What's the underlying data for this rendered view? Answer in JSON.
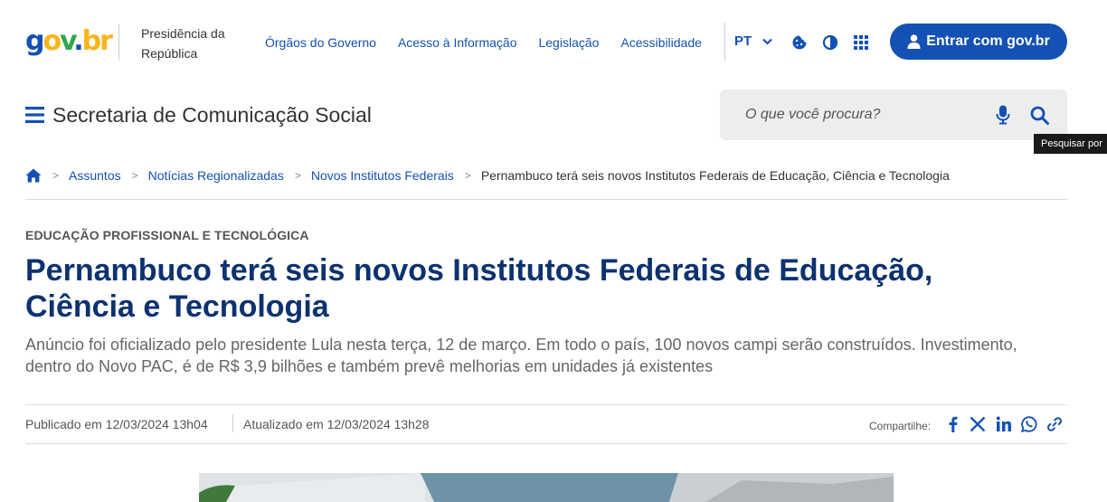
{
  "header": {
    "logo": {
      "g": "g",
      "o": "o",
      "v": "v",
      "dot": ".",
      "br": "br"
    },
    "org_name": "Presidência da República",
    "links": [
      "Órgãos do Governo",
      "Acesso à Informação",
      "Legislação",
      "Acessibilidade"
    ],
    "language": "PT",
    "login_label": "Entrar com gov.br",
    "site_title": "Secretaria de Comunicação Social",
    "search_placeholder": "O que você procura?",
    "search_tooltip": "Pesquisar por"
  },
  "breadcrumb": {
    "items": [
      "Assuntos",
      "Notícias Regionalizadas",
      "Novos Institutos Federais"
    ],
    "current": "Pernambuco terá seis novos Institutos Federais de Educação, Ciência e Tecnologia"
  },
  "article": {
    "kicker": "EDUCAÇÃO PROFISSIONAL E TECNOLÓGICA",
    "title": "Pernambuco terá seis novos Institutos Federais de Educação, Ciência e Tecnologia",
    "subtitle": "Anúncio foi oficializado pelo presidente Lula nesta terça, 12 de março. Em todo o país, 100 novos campi serão construídos. Investimento, dentro do Novo PAC, é de R$ 3,9 bilhões e também prevê melhorias em unidades já existentes",
    "published": "Publicado em 12/03/2024 13h04",
    "updated": "Atualizado em 12/03/2024 13h28",
    "share_label": "Compartilhe:",
    "share_icons": [
      "facebook-icon",
      "x-icon",
      "linkedin-icon",
      "whatsapp-icon",
      "link-icon"
    ]
  },
  "colors": {
    "primary": "#1351b4",
    "headline": "#0c326f",
    "logo_yellow": "#f8b41a",
    "logo_green": "#2fa84f"
  }
}
